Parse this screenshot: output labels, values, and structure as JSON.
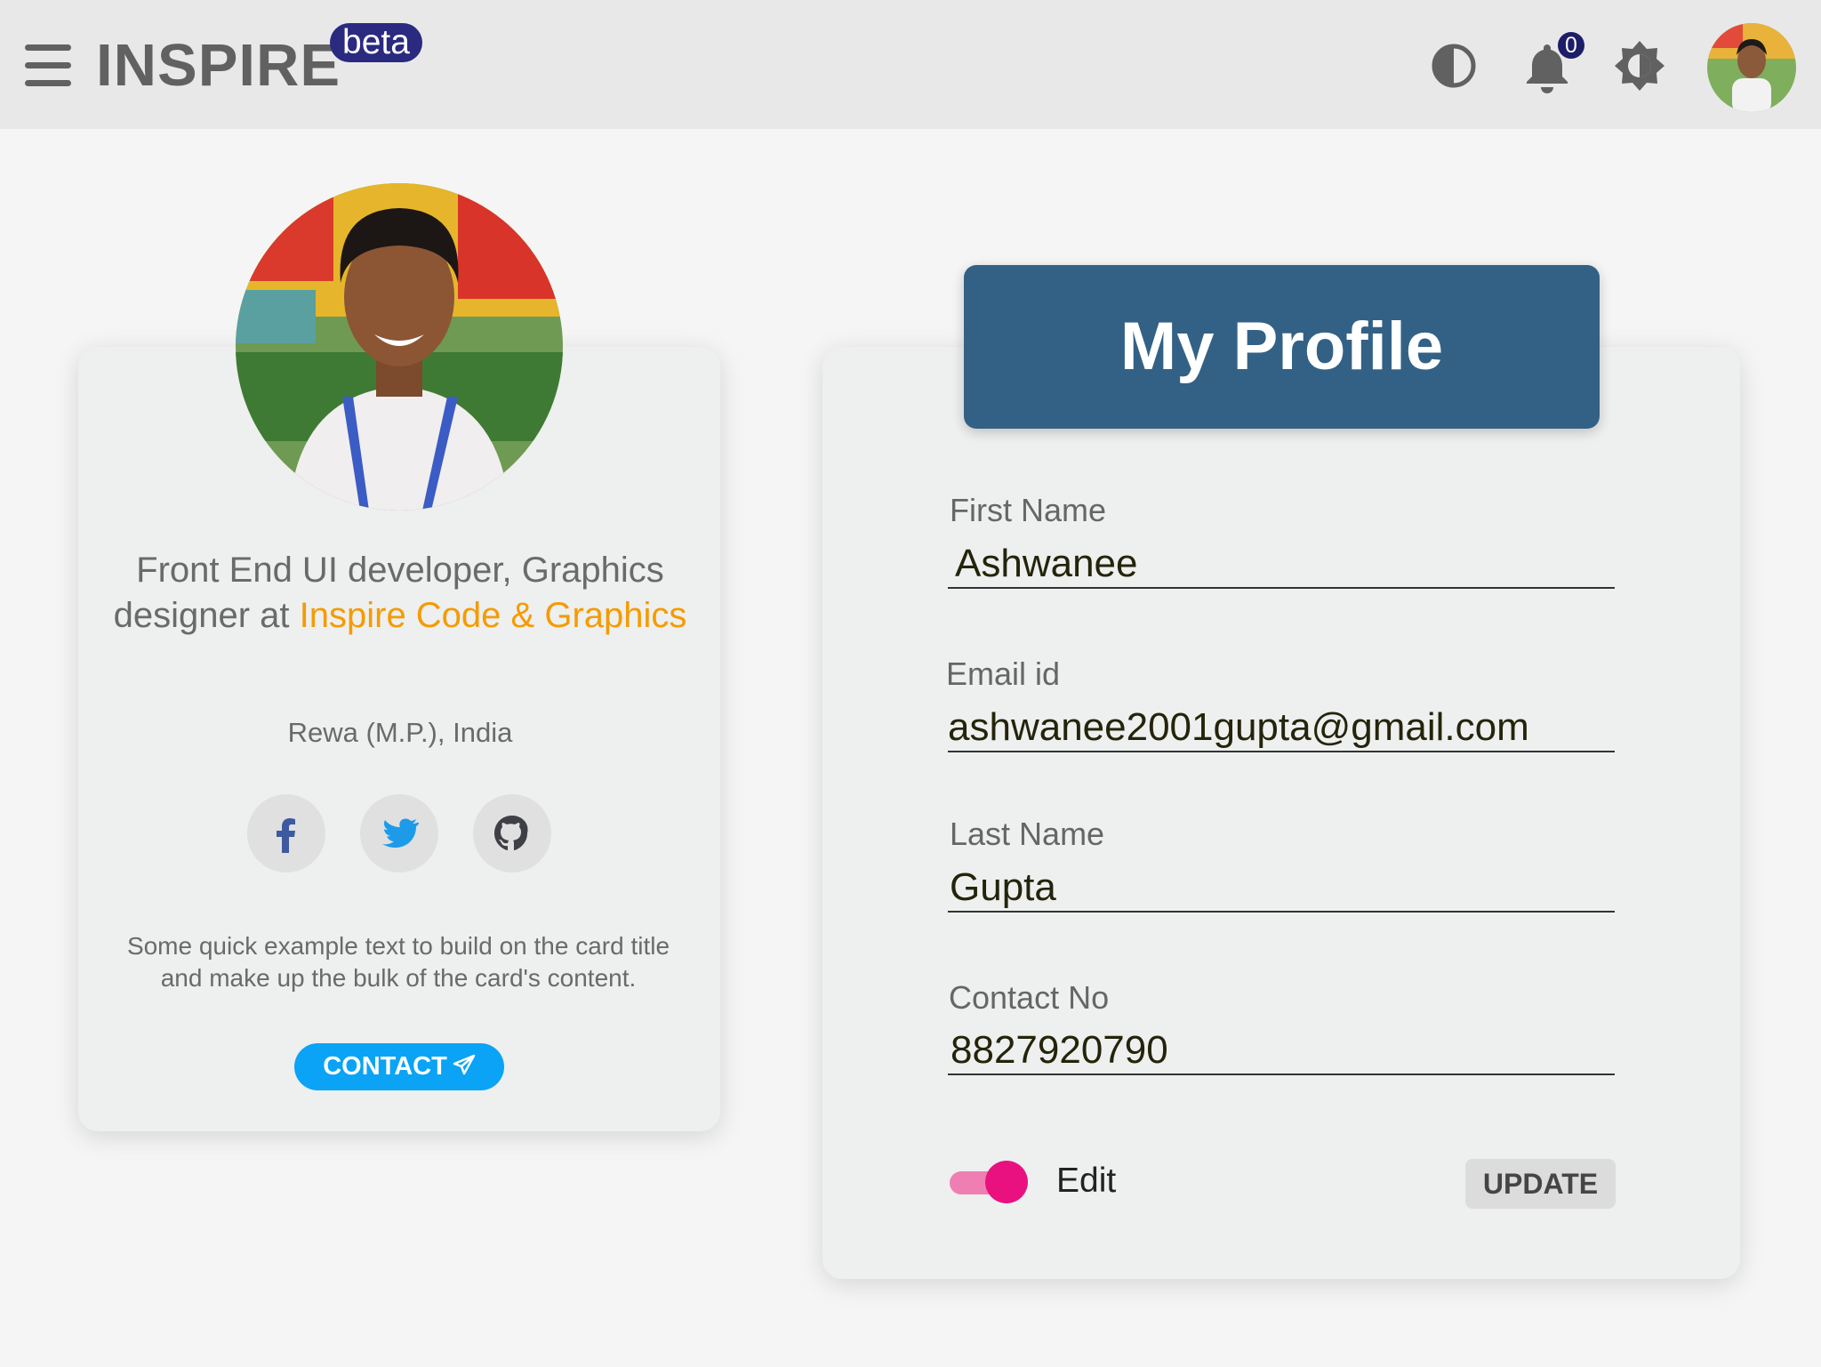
{
  "app": {
    "title": "INSPIRE",
    "badge": "beta"
  },
  "header": {
    "notification_count": "0",
    "icons": [
      "menu-icon",
      "contrast-icon",
      "bell-icon",
      "brightness-icon",
      "avatar"
    ]
  },
  "profile_card": {
    "bio_prefix": "Front End UI developer, Graphics designer at ",
    "company": "Inspire Code & Graphics",
    "location": "Rewa (M.P.), India",
    "social": [
      "facebook-icon",
      "twitter-icon",
      "github-icon"
    ],
    "blurb": "Some quick example text to build on the card title and make up the bulk of the card's content.",
    "contact_label": "CONTACT"
  },
  "form": {
    "title": "My Profile",
    "first_name_label": "First Name",
    "first_name": "Ashwanee",
    "email_label": "Email id",
    "email": "ashwanee2001gupta@gmail.com",
    "last_name_label": "Last Name",
    "last_name": "Gupta",
    "contact_label": "Contact No",
    "contact": "8827920790",
    "edit_label": "Edit",
    "edit_enabled": true,
    "update_label": "UPDATE"
  },
  "colors": {
    "header_bg": "#336186",
    "accent_orange": "#f59b00",
    "contact_btn": "#0aa3f5",
    "toggle_pink": "#e8117f",
    "badge_bg": "#2a2a80"
  }
}
